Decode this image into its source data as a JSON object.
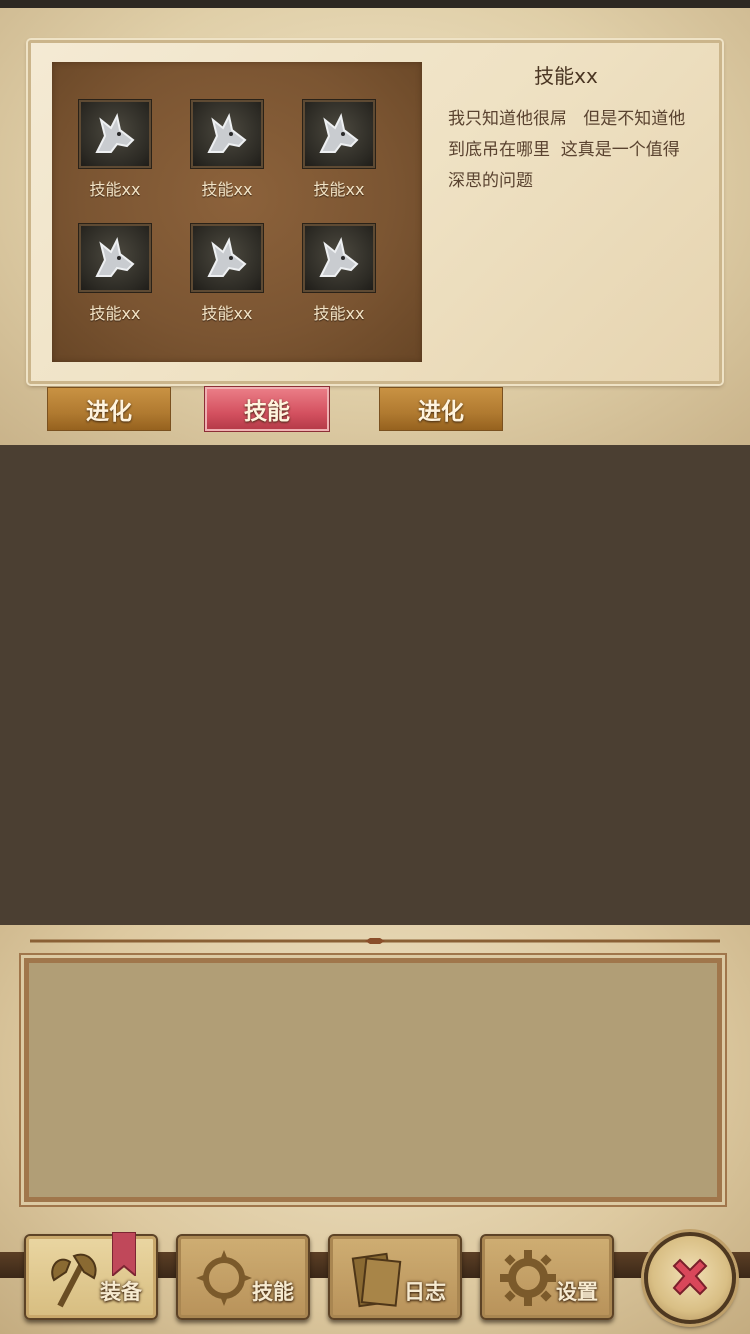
{
  "skills_panel": {
    "skills": [
      {
        "label": "技能xx",
        "icon": "wolf-head-icon"
      },
      {
        "label": "技能xx",
        "icon": "wolf-head-icon"
      },
      {
        "label": "技能xx",
        "icon": "wolf-head-icon"
      },
      {
        "label": "技能xx",
        "icon": "wolf-head-icon"
      },
      {
        "label": "技能xx",
        "icon": "wolf-head-icon"
      },
      {
        "label": "技能xx",
        "icon": "wolf-head-icon"
      }
    ],
    "detail": {
      "title": "技能xx",
      "description": "我只知道他很屌   但是不知道他\n到底吊在哪里  这真是一个值得\n深思的问题"
    }
  },
  "tabs": [
    {
      "label": "进化",
      "active": false
    },
    {
      "label": "技能",
      "active": true
    },
    {
      "label": "进化",
      "active": false
    }
  ],
  "bottom_nav": {
    "items": [
      {
        "label": "装备",
        "icon": "axe-icon",
        "active": true
      },
      {
        "label": "技能",
        "icon": "skill-emblem-icon",
        "active": false
      },
      {
        "label": "日志",
        "icon": "scroll-icon",
        "active": false
      },
      {
        "label": "设置",
        "icon": "gear-icon",
        "active": false
      }
    ],
    "close_icon": "close-x-icon"
  },
  "colors": {
    "parchment": "#efe2c4",
    "skill_grid_bg": "#7b5532",
    "tab_gold": "#b07a30",
    "tab_red": "#d45160",
    "middle_bg": "#4b3f32",
    "log_box": "#b19e76",
    "close_x": "#d9475a"
  }
}
